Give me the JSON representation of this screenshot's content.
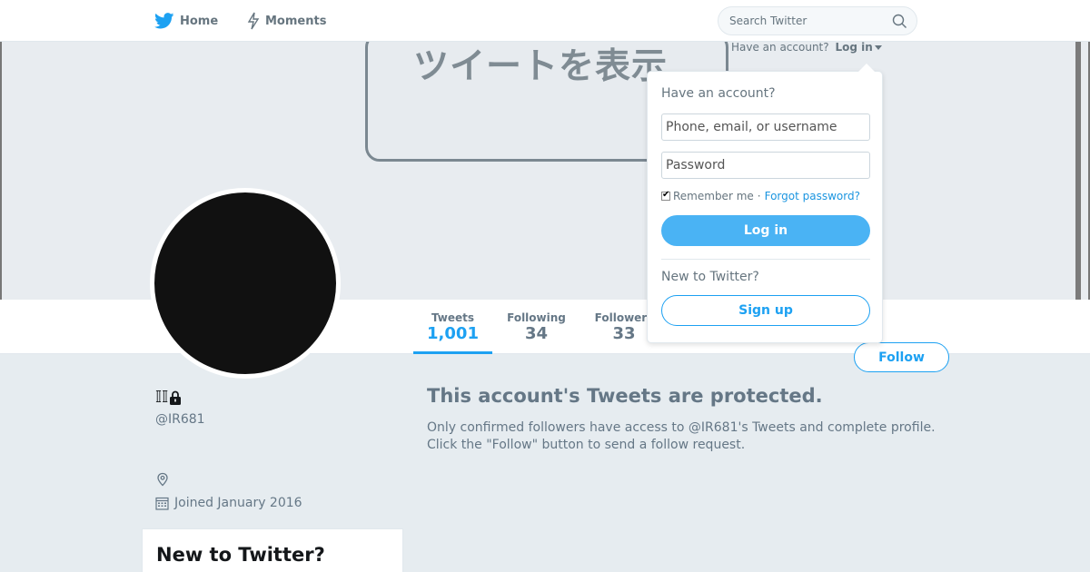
{
  "nav": {
    "home_label": "Home",
    "moments_label": "Moments",
    "home_icon": "twitter-bird-icon",
    "moments_icon": "lightning-icon"
  },
  "search": {
    "placeholder": "Search Twitter",
    "icon": "search-icon"
  },
  "banner": {
    "text": "ツイートを表示"
  },
  "account_hint": {
    "text": "Have an account?",
    "login_label": "Log in"
  },
  "stats": {
    "tweets_label": "Tweets",
    "tweets_value": "1,001",
    "following_label": "Following",
    "following_value": "34",
    "followers_label": "Followers",
    "followers_value": "33"
  },
  "follow_button": "Follow",
  "profile": {
    "name": "𝕀𝕀",
    "handle": "@IR681",
    "joined": "Joined January 2016"
  },
  "protected": {
    "title": "This account's Tweets are protected.",
    "body": "Only confirmed followers have access to @IR681's Tweets and complete profile. Click the \"Follow\" button to send a follow request."
  },
  "new_card": {
    "title": "New to Twitter?"
  },
  "login_dropdown": {
    "heading": "Have an account?",
    "phone_placeholder": "Phone, email, or username",
    "password_placeholder": "Password",
    "remember_label": "Remember me",
    "separator": "·",
    "forgot_label": "Forgot password?",
    "login_button": "Log in",
    "new_heading": "New to Twitter?",
    "signup_button": "Sign up"
  },
  "colors": {
    "accent": "#1da1f2",
    "login_button_bg": "#4ab3f4",
    "page_bg": "#e6ecf0",
    "avatar": "#111111"
  }
}
